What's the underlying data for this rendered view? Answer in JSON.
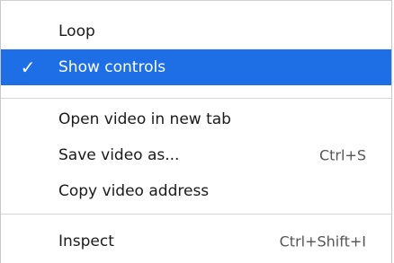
{
  "menu": {
    "items": [
      {
        "label": "Loop",
        "shortcut": "",
        "checked": false
      },
      {
        "label": "Show controls",
        "shortcut": "",
        "checked": true,
        "highlighted": true
      },
      {
        "label": "Open video in new tab",
        "shortcut": ""
      },
      {
        "label": "Save video as...",
        "shortcut": "Ctrl+S"
      },
      {
        "label": "Copy video address",
        "shortcut": ""
      },
      {
        "label": "Inspect",
        "shortcut": "Ctrl+Shift+I"
      }
    ]
  },
  "colors": {
    "highlight": "#1e6fe6",
    "separator": "#d6d6d6",
    "text": "#1a1a1a"
  },
  "icons": {
    "check": "check-icon"
  }
}
